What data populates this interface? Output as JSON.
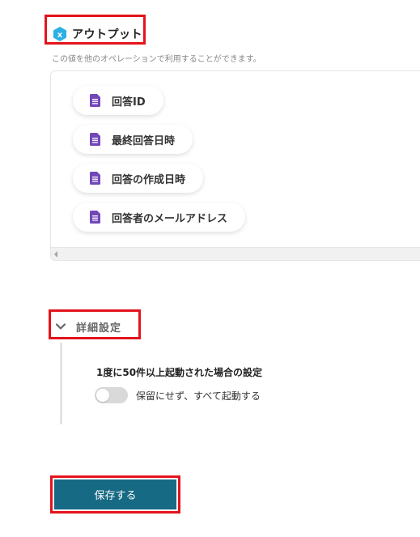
{
  "output": {
    "title": "アウトプット",
    "description": "この値を他のオペレーションで利用することができます。",
    "items": [
      {
        "label": "回答ID",
        "icon": "google-forms-doc-icon"
      },
      {
        "label": "最終回答日時",
        "icon": "google-forms-doc-icon"
      },
      {
        "label": "回答の作成日時",
        "icon": "google-forms-doc-icon"
      },
      {
        "label": "回答者のメールアドレス",
        "icon": "google-forms-doc-icon"
      }
    ]
  },
  "advanced": {
    "title": "詳細設定",
    "setting_label": "1度に50件以上起動された場合の設定",
    "toggle_label": "保留にせず、すべて起動する",
    "toggle_on": false
  },
  "save_button": {
    "label": "保存する"
  },
  "colors": {
    "highlight": "#e3141c",
    "primary_button": "#176a83",
    "doc_icon": "#7248b9",
    "output_icon": "#2ab0e3"
  }
}
